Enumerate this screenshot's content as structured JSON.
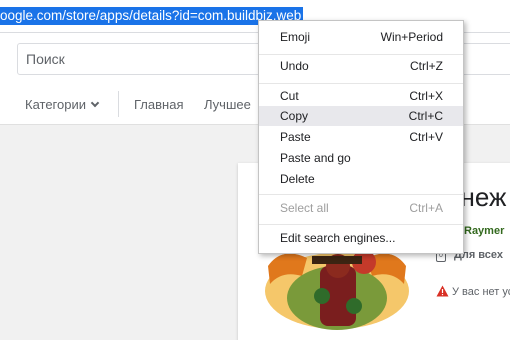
{
  "address_bar": {
    "url": "oogle.com/store/apps/details?id=com.buildbiz.web"
  },
  "store": {
    "search_placeholder": "Поиск",
    "nav": {
      "categories": "Категории",
      "home": "Главная",
      "top": "Лучшее"
    }
  },
  "app": {
    "title_partial": "енеж",
    "developer": "Raymer",
    "rating": "Для всех",
    "warning": "У вас нет ус"
  },
  "context_menu": {
    "items": [
      {
        "label": "Emoji",
        "shortcut": "Win+Period"
      },
      {
        "label": "Undo",
        "shortcut": "Ctrl+Z"
      },
      {
        "label": "Cut",
        "shortcut": "Ctrl+X"
      },
      {
        "label": "Copy",
        "shortcut": "Ctrl+C"
      },
      {
        "label": "Paste",
        "shortcut": "Ctrl+V"
      },
      {
        "label": "Paste and go",
        "shortcut": ""
      },
      {
        "label": "Delete",
        "shortcut": ""
      },
      {
        "label": "Select all",
        "shortcut": "Ctrl+A"
      },
      {
        "label": "Edit search engines...",
        "shortcut": ""
      }
    ],
    "highlighted": "Copy",
    "disabled": "Select all"
  },
  "colors": {
    "selection": "#1a73e8",
    "developer": "#33691e",
    "warning": "#d93025"
  },
  "icons": {
    "nav_dropdown": "chevron-down-icon",
    "rating": "rating-badge-icon",
    "warning": "warning-triangle-icon",
    "app": "app-logo-icon"
  }
}
